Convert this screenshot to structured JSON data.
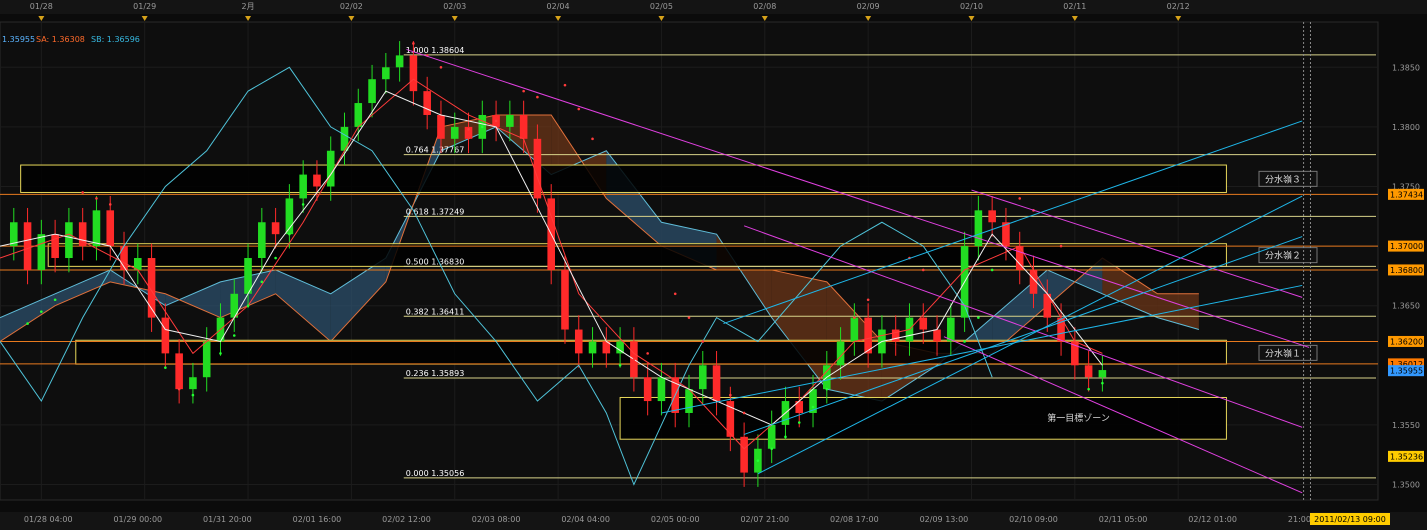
{
  "chart_data": {
    "type": "line",
    "instrument_info": {
      "price_label": "1.35955",
      "sa_label": "SA: 1.36308",
      "sb_label": "SB: 1.36596",
      "price_color": "#5ab4ff",
      "sa_color": "#ff6a2a",
      "sb_color": "#36b8e0"
    },
    "ylim": [
      1.3487,
      1.3888
    ],
    "xlim": [
      0,
      100
    ],
    "top_dates": [
      {
        "x": 3.0,
        "label": "01/28"
      },
      {
        "x": 10.5,
        "label": "01/29"
      },
      {
        "x": 18.0,
        "label": "2月"
      },
      {
        "x": 25.5,
        "label": "02/02"
      },
      {
        "x": 33.0,
        "label": "02/03"
      },
      {
        "x": 40.5,
        "label": "02/04"
      },
      {
        "x": 48.0,
        "label": "02/05"
      },
      {
        "x": 55.5,
        "label": "02/08"
      },
      {
        "x": 63.0,
        "label": "02/09"
      },
      {
        "x": 70.5,
        "label": "02/10"
      },
      {
        "x": 78.0,
        "label": "02/11"
      },
      {
        "x": 85.5,
        "label": "02/12"
      }
    ],
    "bottom_times": [
      {
        "x": 3.5,
        "label": "01/28 04:00"
      },
      {
        "x": 10.0,
        "label": "01/29 00:00"
      },
      {
        "x": 16.5,
        "label": "01/31 20:00"
      },
      {
        "x": 23.0,
        "label": "02/01 16:00"
      },
      {
        "x": 29.5,
        "label": "02/02 12:00"
      },
      {
        "x": 36.0,
        "label": "02/03 08:00"
      },
      {
        "x": 42.5,
        "label": "02/04 04:00"
      },
      {
        "x": 49.0,
        "label": "02/05 00:00"
      },
      {
        "x": 55.5,
        "label": "02/07 21:00"
      },
      {
        "x": 62.0,
        "label": "02/08 17:00"
      },
      {
        "x": 68.5,
        "label": "02/09 13:00"
      },
      {
        "x": 75.0,
        "label": "02/10 09:00"
      },
      {
        "x": 81.5,
        "label": "02/11 05:00"
      },
      {
        "x": 88.0,
        "label": "02/12 01:00"
      },
      {
        "x": 94.3,
        "label": "21:00"
      }
    ],
    "current_time_label": "2011/02/13 09:00",
    "y_ticks": [
      {
        "value": 1.385,
        "label": "1.3850"
      },
      {
        "value": 1.38,
        "label": "1.3800"
      },
      {
        "value": 1.375,
        "label": "1.3750"
      },
      {
        "value": 1.365,
        "label": "1.3650"
      },
      {
        "value": 1.355,
        "label": "1.3550"
      },
      {
        "value": 1.35,
        "label": "1.3500"
      }
    ],
    "price_badges": [
      {
        "value": 1.37434,
        "label": "1.37434",
        "bg": "#ff9900",
        "fg": "#000000"
      },
      {
        "value": 1.37,
        "label": "1.37000",
        "bg": "#ff9900",
        "fg": "#000000"
      },
      {
        "value": 1.368,
        "label": "1.36800",
        "bg": "#ff9900",
        "fg": "#000000"
      },
      {
        "value": 1.362,
        "label": "1.36200",
        "bg": "#ff9900",
        "fg": "#000000"
      },
      {
        "value": 1.36012,
        "label": "1.36012",
        "bg": "#ff7a00",
        "fg": "#000000"
      },
      {
        "value": 1.35955,
        "label": "1.35955",
        "bg": "#3399ff",
        "fg": "#000000"
      },
      {
        "value": 1.35236,
        "label": "1.35236",
        "bg": "#ffcc00",
        "fg": "#000000"
      }
    ],
    "fib_levels": [
      {
        "ratio": "1.000",
        "value": 1.38604,
        "label": "1.000  1.38604"
      },
      {
        "ratio": "0.764",
        "value": 1.37767,
        "label": "0.764  1.37767"
      },
      {
        "ratio": "0.618",
        "value": 1.37249,
        "label": "0.618  1.37249"
      },
      {
        "ratio": "0.500",
        "value": 1.3683,
        "label": "0.500  1.36830"
      },
      {
        "ratio": "0.382",
        "value": 1.36411,
        "label": "0.382  1.36411"
      },
      {
        "ratio": "0.236",
        "value": 1.35893,
        "label": "0.236  1.35893"
      },
      {
        "ratio": "0.000",
        "value": 1.35056,
        "label": "0.000  1.35056"
      }
    ],
    "fib_x_start": 29.3,
    "zones": [
      {
        "label": "分水嶺３",
        "x0": 1.5,
        "x1": 89.0,
        "y_top": 1.3768,
        "y_bot": 1.3745
      },
      {
        "label": "分水嶺２",
        "x0": 3.5,
        "x1": 89.0,
        "y_top": 1.3702,
        "y_bot": 1.3683
      },
      {
        "label": "分水嶺１",
        "x0": 5.5,
        "x1": 89.0,
        "y_top": 1.3621,
        "y_bot": 1.3601
      },
      {
        "label": "第一目標ゾーン",
        "x0": 45.0,
        "x1": 89.0,
        "y_top": 1.3573,
        "y_bot": 1.3538
      }
    ],
    "zone_label_boxes": [
      {
        "label": "分水嶺３",
        "x": 91.8,
        "y": 1.3756
      },
      {
        "label": "分水嶺２",
        "x": 91.8,
        "y": 1.3692
      },
      {
        "label": "分水嶺１",
        "x": 91.8,
        "y": 1.361
      }
    ],
    "orange_lines": [
      1.37434,
      1.37,
      1.368,
      1.362,
      1.36012
    ],
    "target_zone_label": {
      "x": 76.0,
      "y": 1.3556
    },
    "trendlines_magenta": [
      {
        "x0": 29.5,
        "y0": 1.3865,
        "x1": 95.0,
        "y1": 1.3615
      },
      {
        "x0": 54.0,
        "y0": 1.3717,
        "x1": 94.5,
        "y1": 1.3548
      },
      {
        "x0": 68.5,
        "y0": 1.3624,
        "x1": 94.5,
        "y1": 1.3493
      },
      {
        "x0": 70.5,
        "y0": 1.3747,
        "x1": 94.5,
        "y1": 1.3657
      }
    ],
    "trendlines_cyan": [
      {
        "x0": 48.0,
        "y0": 1.356,
        "x1": 94.5,
        "y1": 1.3667
      },
      {
        "x0": 52.5,
        "y0": 1.3635,
        "x1": 94.5,
        "y1": 1.3805
      },
      {
        "x0": 55.0,
        "y0": 1.3509,
        "x1": 94.5,
        "y1": 1.3742
      },
      {
        "x0": 54.0,
        "y0": 1.3542,
        "x1": 94.5,
        "y1": 1.3708
      }
    ],
    "v_dashed_x": [
      94.6,
      95.1
    ],
    "close_series": [
      [
        0,
        1.37
      ],
      [
        1,
        1.372
      ],
      [
        2,
        1.368
      ],
      [
        3,
        1.371
      ],
      [
        4,
        1.369
      ],
      [
        5,
        1.372
      ],
      [
        6,
        1.37
      ],
      [
        7,
        1.373
      ],
      [
        8,
        1.37
      ],
      [
        9,
        1.368
      ],
      [
        10,
        1.369
      ],
      [
        11,
        1.364
      ],
      [
        12,
        1.361
      ],
      [
        13,
        1.358
      ],
      [
        14,
        1.359
      ],
      [
        15,
        1.362
      ],
      [
        16,
        1.364
      ],
      [
        17,
        1.366
      ],
      [
        18,
        1.369
      ],
      [
        19,
        1.372
      ],
      [
        20,
        1.371
      ],
      [
        21,
        1.374
      ],
      [
        22,
        1.376
      ],
      [
        23,
        1.375
      ],
      [
        24,
        1.378
      ],
      [
        25,
        1.38
      ],
      [
        26,
        1.382
      ],
      [
        27,
        1.384
      ],
      [
        28,
        1.385
      ],
      [
        29,
        1.386
      ],
      [
        30,
        1.383
      ],
      [
        31,
        1.381
      ],
      [
        32,
        1.379
      ],
      [
        33,
        1.38
      ],
      [
        34,
        1.379
      ],
      [
        35,
        1.381
      ],
      [
        36,
        1.38
      ],
      [
        37,
        1.381
      ],
      [
        38,
        1.379
      ],
      [
        39,
        1.374
      ],
      [
        40,
        1.368
      ],
      [
        41,
        1.363
      ],
      [
        42,
        1.361
      ],
      [
        43,
        1.362
      ],
      [
        44,
        1.361
      ],
      [
        45,
        1.362
      ],
      [
        46,
        1.359
      ],
      [
        47,
        1.357
      ],
      [
        48,
        1.359
      ],
      [
        49,
        1.356
      ],
      [
        50,
        1.358
      ],
      [
        51,
        1.36
      ],
      [
        52,
        1.357
      ],
      [
        53,
        1.354
      ],
      [
        54,
        1.351
      ],
      [
        55,
        1.353
      ],
      [
        56,
        1.355
      ],
      [
        57,
        1.357
      ],
      [
        58,
        1.356
      ],
      [
        59,
        1.358
      ],
      [
        60,
        1.36
      ],
      [
        61,
        1.362
      ],
      [
        62,
        1.364
      ],
      [
        63,
        1.361
      ],
      [
        64,
        1.363
      ],
      [
        65,
        1.362
      ],
      [
        66,
        1.364
      ],
      [
        67,
        1.363
      ],
      [
        68,
        1.362
      ],
      [
        69,
        1.364
      ],
      [
        70,
        1.37
      ],
      [
        71,
        1.373
      ],
      [
        72,
        1.372
      ],
      [
        73,
        1.37
      ],
      [
        74,
        1.368
      ],
      [
        75,
        1.366
      ],
      [
        76,
        1.364
      ],
      [
        77,
        1.362
      ],
      [
        78,
        1.36
      ],
      [
        79,
        1.359
      ],
      [
        80,
        1.3596
      ]
    ],
    "ma_white": [
      [
        0,
        1.37
      ],
      [
        4,
        1.371
      ],
      [
        8,
        1.37
      ],
      [
        12,
        1.363
      ],
      [
        16,
        1.362
      ],
      [
        20,
        1.37
      ],
      [
        24,
        1.376
      ],
      [
        28,
        1.383
      ],
      [
        32,
        1.381
      ],
      [
        36,
        1.38
      ],
      [
        40,
        1.371
      ],
      [
        44,
        1.362
      ],
      [
        48,
        1.359
      ],
      [
        52,
        1.357
      ],
      [
        56,
        1.355
      ],
      [
        60,
        1.359
      ],
      [
        64,
        1.362
      ],
      [
        68,
        1.363
      ],
      [
        72,
        1.371
      ],
      [
        76,
        1.366
      ],
      [
        80,
        1.36
      ]
    ],
    "ma_red": [
      [
        0,
        1.369
      ],
      [
        5,
        1.371
      ],
      [
        10,
        1.368
      ],
      [
        14,
        1.361
      ],
      [
        18,
        1.365
      ],
      [
        22,
        1.372
      ],
      [
        26,
        1.38
      ],
      [
        30,
        1.384
      ],
      [
        34,
        1.381
      ],
      [
        38,
        1.379
      ],
      [
        42,
        1.366
      ],
      [
        46,
        1.361
      ],
      [
        50,
        1.358
      ],
      [
        54,
        1.353
      ],
      [
        58,
        1.357
      ],
      [
        62,
        1.362
      ],
      [
        66,
        1.363
      ],
      [
        70,
        1.368
      ],
      [
        74,
        1.37
      ],
      [
        78,
        1.362
      ],
      [
        80,
        1.361
      ]
    ],
    "chikou": [
      [
        0,
        1.362
      ],
      [
        3,
        1.357
      ],
      [
        6,
        1.364
      ],
      [
        9,
        1.37
      ],
      [
        12,
        1.375
      ],
      [
        15,
        1.378
      ],
      [
        18,
        1.383
      ],
      [
        21,
        1.385
      ],
      [
        24,
        1.38
      ],
      [
        27,
        1.378
      ],
      [
        30,
        1.373
      ],
      [
        33,
        1.366
      ],
      [
        36,
        1.362
      ],
      [
        39,
        1.357
      ],
      [
        42,
        1.36
      ],
      [
        44,
        1.356
      ],
      [
        46,
        1.35
      ],
      [
        48,
        1.355
      ],
      [
        50,
        1.36
      ],
      [
        52,
        1.364
      ],
      [
        55,
        1.362
      ],
      [
        58,
        1.366
      ],
      [
        61,
        1.37
      ],
      [
        64,
        1.372
      ],
      [
        67,
        1.37
      ],
      [
        70,
        1.365
      ],
      [
        72,
        1.359
      ]
    ],
    "kumo": [
      {
        "x": 0,
        "a": 1.364,
        "b": 1.362
      },
      {
        "x": 4,
        "a": 1.366,
        "b": 1.365
      },
      {
        "x": 8,
        "a": 1.368,
        "b": 1.367
      },
      {
        "x": 12,
        "a": 1.365,
        "b": 1.366
      },
      {
        "x": 16,
        "a": 1.367,
        "b": 1.364
      },
      {
        "x": 20,
        "a": 1.368,
        "b": 1.366
      },
      {
        "x": 24,
        "a": 1.366,
        "b": 1.362
      },
      {
        "x": 28,
        "a": 1.369,
        "b": 1.367
      },
      {
        "x": 32,
        "a": 1.378,
        "b": 1.38
      },
      {
        "x": 36,
        "a": 1.38,
        "b": 1.381
      },
      {
        "x": 40,
        "a": 1.376,
        "b": 1.381
      },
      {
        "x": 44,
        "a": 1.378,
        "b": 1.374
      },
      {
        "x": 48,
        "a": 1.372,
        "b": 1.37
      },
      {
        "x": 52,
        "a": 1.371,
        "b": 1.368
      },
      {
        "x": 56,
        "a": 1.364,
        "b": 1.368
      },
      {
        "x": 60,
        "a": 1.358,
        "b": 1.367
      },
      {
        "x": 64,
        "a": 1.357,
        "b": 1.362
      },
      {
        "x": 68,
        "a": 1.36,
        "b": 1.361
      },
      {
        "x": 72,
        "a": 1.364,
        "b": 1.361
      },
      {
        "x": 76,
        "a": 1.368,
        "b": 1.365
      },
      {
        "x": 80,
        "a": 1.366,
        "b": 1.369
      },
      {
        "x": 84,
        "a": 1.364,
        "b": 1.366
      },
      {
        "x": 87,
        "a": 1.363,
        "b": 1.366
      }
    ],
    "sar_dots": [
      [
        2,
        1.3635
      ],
      [
        3,
        1.3645
      ],
      [
        4,
        1.3655
      ],
      [
        6,
        1.3745
      ],
      [
        7,
        1.374
      ],
      [
        8,
        1.3735
      ],
      [
        12,
        1.3598
      ],
      [
        13,
        1.358
      ],
      [
        14,
        1.3575
      ],
      [
        16,
        1.361
      ],
      [
        17,
        1.3625
      ],
      [
        18,
        1.365
      ],
      [
        19,
        1.367
      ],
      [
        20,
        1.369
      ],
      [
        21,
        1.371
      ],
      [
        22,
        1.3735
      ],
      [
        30,
        1.387
      ],
      [
        31,
        1.386
      ],
      [
        32,
        1.385
      ],
      [
        34,
        1.3798
      ],
      [
        35,
        1.38
      ],
      [
        36,
        1.3805
      ],
      [
        38,
        1.383
      ],
      [
        39,
        1.3825
      ],
      [
        41,
        1.3835
      ],
      [
        42,
        1.3815
      ],
      [
        43,
        1.379
      ],
      [
        45,
        1.36
      ],
      [
        46,
        1.3605
      ],
      [
        47,
        1.361
      ],
      [
        49,
        1.366
      ],
      [
        50,
        1.364
      ],
      [
        51,
        1.362
      ],
      [
        53,
        1.3575
      ],
      [
        54,
        1.356
      ],
      [
        55,
        1.352
      ],
      [
        56,
        1.353
      ],
      [
        57,
        1.354
      ],
      [
        58,
        1.3552
      ],
      [
        59,
        1.3565
      ],
      [
        60,
        1.358
      ],
      [
        62,
        1.364
      ],
      [
        63,
        1.3655
      ],
      [
        66,
        1.369
      ],
      [
        67,
        1.368
      ],
      [
        70,
        1.362
      ],
      [
        71,
        1.364
      ],
      [
        72,
        1.368
      ],
      [
        73,
        1.37
      ],
      [
        74,
        1.374
      ],
      [
        75,
        1.373
      ],
      [
        77,
        1.37
      ],
      [
        78,
        1.368
      ],
      [
        79,
        1.358
      ],
      [
        80,
        1.3585
      ]
    ]
  }
}
